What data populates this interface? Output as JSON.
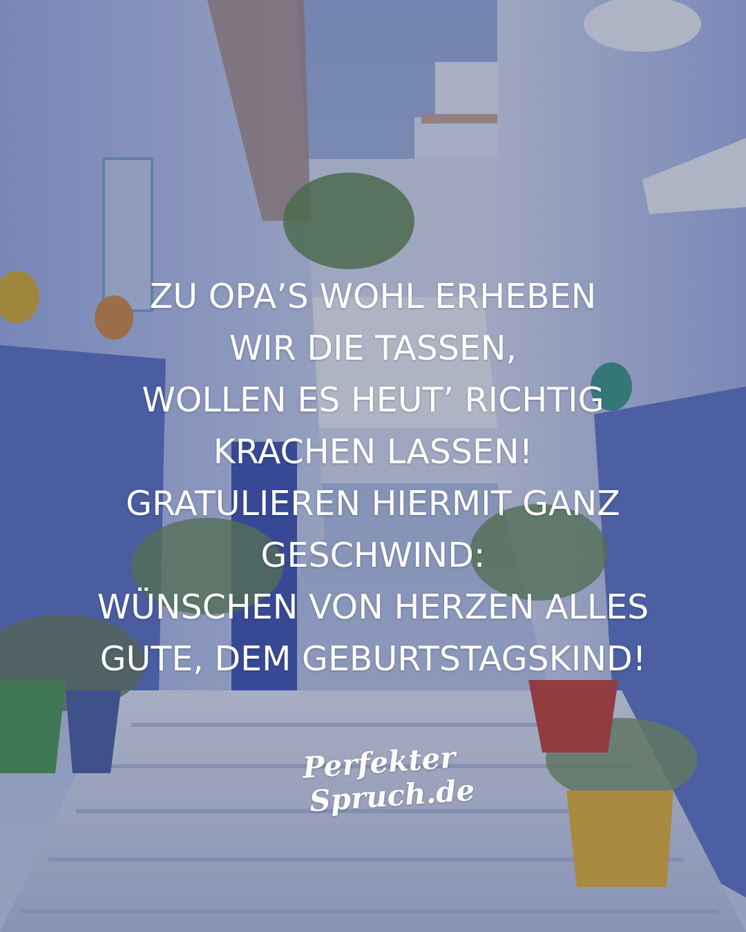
{
  "quote": {
    "lines": [
      "ZU OPA’S WOHL ERHEBEN",
      "WIR DIE TASSEN,",
      "WOLLEN ES HEUT’ RICHTIG",
      "KRACHEN LASSEN!",
      "GRATULIEREN HIERMIT GANZ",
      "GESCHWIND:",
      "WÜNSCHEN VON HERZEN ALLES",
      "GUTE, DEM GEBURTSTAGSKIND!"
    ],
    "color": "#ffffff"
  },
  "logo": {
    "line1": "Perfekter",
    "line2": "Spruch.de"
  },
  "background": {
    "sky_color": "#8ea6d4",
    "wall_color": "#b9c7ee",
    "blue_wall_color": "#5b72c8",
    "overlay_color": "#1e2846"
  }
}
